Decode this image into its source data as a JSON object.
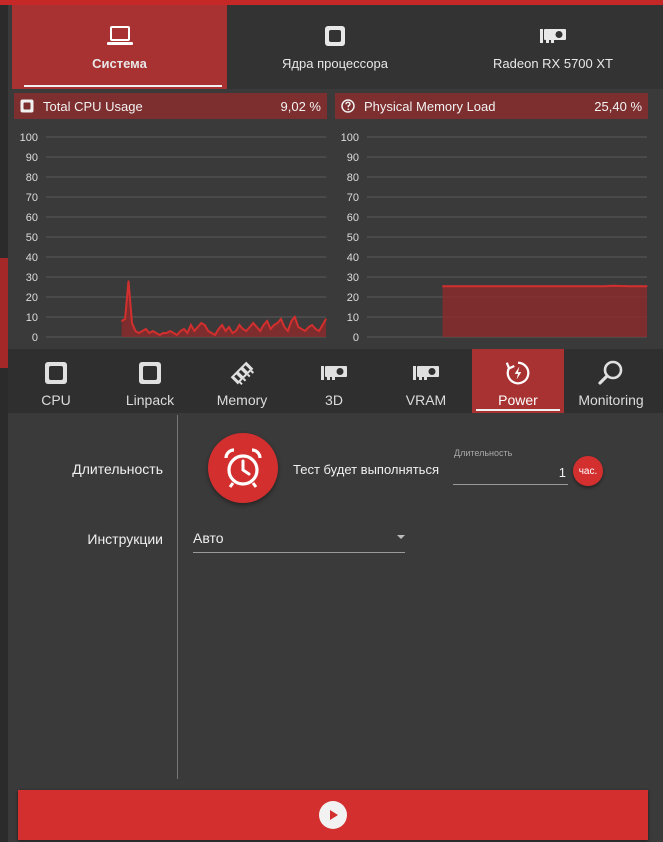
{
  "top_tabs": [
    {
      "label": "Система",
      "icon": "laptop-icon",
      "active": true
    },
    {
      "label": "Ядра процессора",
      "icon": "cpu-chip-icon",
      "active": false
    },
    {
      "label": "Radeon RX 5700 XT",
      "icon": "gpu-card-icon",
      "active": false
    }
  ],
  "cpu_chart": {
    "title": "Total CPU Usage",
    "value": "9,02 %",
    "icon": "cpu-chip-icon"
  },
  "mem_chart": {
    "title": "Physical Memory Load",
    "value": "25,40 %",
    "icon": "question-circle-icon"
  },
  "chart_data": [
    {
      "type": "area",
      "title": "Total CPU Usage",
      "ylim": [
        0,
        100
      ],
      "yticks": [
        "100",
        "90",
        "80",
        "70",
        "60",
        "50",
        "40",
        "30",
        "20",
        "10",
        "0"
      ],
      "grid": true,
      "series": [
        {
          "values": [
            8,
            9,
            28,
            7,
            3,
            2,
            3,
            4,
            2,
            3,
            2,
            1,
            2,
            2,
            3,
            2,
            1,
            3,
            4,
            2,
            6,
            3,
            5,
            7,
            6,
            3,
            2,
            1,
            4,
            6,
            3,
            5,
            2,
            3,
            6,
            4,
            3,
            5,
            7,
            5,
            3,
            6,
            8,
            4,
            6,
            7,
            9,
            5,
            3,
            8,
            10,
            5,
            4,
            3,
            5,
            6,
            4,
            3,
            6,
            9
          ]
        }
      ],
      "color": "#d32f2f"
    },
    {
      "type": "area",
      "title": "Physical Memory Load",
      "ylim": [
        0,
        100
      ],
      "yticks": [
        "100",
        "90",
        "80",
        "70",
        "60",
        "50",
        "40",
        "30",
        "20",
        "10",
        "0"
      ],
      "grid": true,
      "series": [
        {
          "values": [
            25.4,
            25.4,
            25.4,
            25.4,
            25.4,
            25.4,
            25.4,
            25.4,
            25.4,
            25.4,
            25.4,
            25.4,
            25.4,
            25.4,
            25.4,
            25.4,
            25.4,
            25.4,
            25.4,
            25.4,
            25.6,
            25.5,
            25.4,
            25.4,
            25.4
          ]
        }
      ],
      "color": "#d32f2f"
    }
  ],
  "sub_tabs": [
    {
      "label": "CPU",
      "icon": "cpu-chip-icon",
      "active": false
    },
    {
      "label": "Linpack",
      "icon": "cpu-chip-icon",
      "active": false
    },
    {
      "label": "Memory",
      "icon": "memory-stick-icon",
      "active": false
    },
    {
      "label": "3D",
      "icon": "gpu-card-icon",
      "active": false
    },
    {
      "label": "VRAM",
      "icon": "gpu-card-icon",
      "active": false
    },
    {
      "label": "Power",
      "icon": "power-cycle-icon",
      "active": true
    },
    {
      "label": "Monitoring",
      "icon": "magnifier-icon",
      "active": false
    }
  ],
  "settings": {
    "duration_label": "Длительность",
    "test_text": "Тест будет выполняться",
    "duration_caption": "Длительность",
    "duration_value": "1",
    "duration_unit": "час.",
    "instructions_label": "Инструкции",
    "instructions_value": "Авто"
  },
  "start_button": {
    "icon": "play-icon"
  },
  "colors": {
    "accent": "#d32f2f",
    "tab_active": "#a83232",
    "chart_header": "#7d2e2e",
    "background": "#3a3a3a"
  }
}
